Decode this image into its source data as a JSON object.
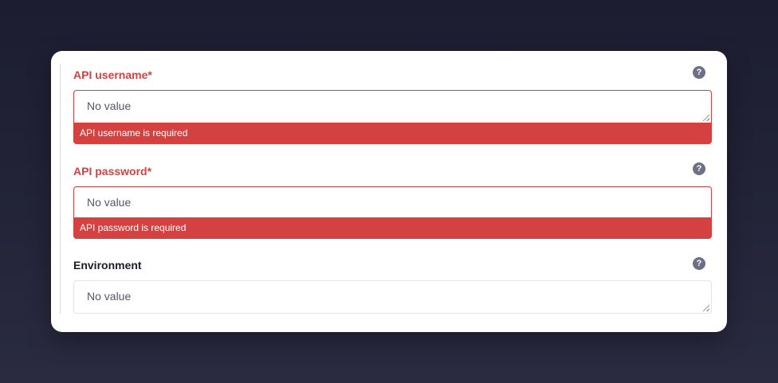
{
  "form": {
    "fields": [
      {
        "label": "API username*",
        "value": "No value",
        "error": "API username is required",
        "help": "?"
      },
      {
        "label": "API password*",
        "value": "No value",
        "error": "API password is required",
        "help": "?"
      },
      {
        "label": "Environment",
        "value": "No value",
        "help": "?"
      }
    ]
  },
  "colors": {
    "error": "#d44141",
    "card": "#ffffff",
    "help_icon": "#6f6f86"
  }
}
